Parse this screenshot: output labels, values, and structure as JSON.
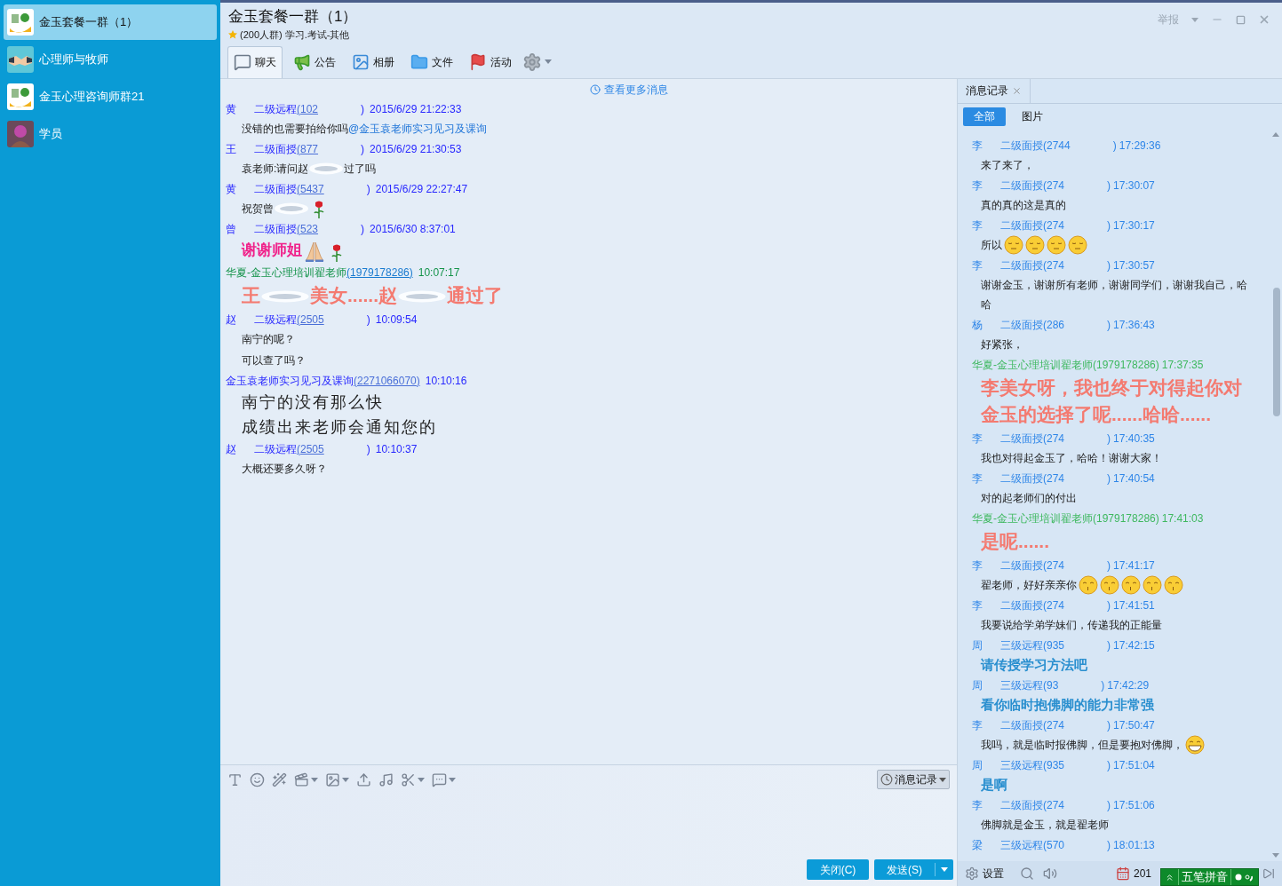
{
  "sidebar": {
    "items": [
      {
        "label": "金玉套餐一群（1）",
        "kind": "logo",
        "selected": true
      },
      {
        "label": "心理师与牧师",
        "kind": "handshake",
        "selected": false
      },
      {
        "label": "金玉心理咨询师群21",
        "kind": "logo",
        "selected": false
      },
      {
        "label": "学员",
        "kind": "person",
        "selected": false
      }
    ]
  },
  "header": {
    "title": "金玉套餐一群（1）",
    "subtitle": "(200人群) 学习.考试-其他",
    "report": "举报"
  },
  "tabs": [
    {
      "label": "聊天",
      "kind": "chat",
      "selected": true
    },
    {
      "label": "公告",
      "kind": "notice",
      "selected": false
    },
    {
      "label": "相册",
      "kind": "album",
      "selected": false
    },
    {
      "label": "文件",
      "kind": "file",
      "selected": false
    },
    {
      "label": "活动",
      "kind": "event",
      "selected": false
    }
  ],
  "chat": {
    "more_link": "查看更多消息",
    "messages": [
      {
        "sender": {
          "name": "黄",
          "role": "二级远程",
          "handle": "(102",
          "handle_end": ")",
          "time": "2015/6/29 21:22:33",
          "kind": "member"
        },
        "kind": "plain",
        "lines": [
          [
            {
              "kind": "text",
              "text": "没错的也需要拍给你吗"
            },
            {
              "kind": "mention",
              "text": "@金玉袁老师实习见习及课询"
            }
          ]
        ]
      },
      {
        "sender": {
          "name": "王",
          "role": "二级面授",
          "handle": "(877",
          "handle_end": ")",
          "time": "2015/6/29 21:30:53",
          "kind": "member"
        },
        "kind": "plain",
        "lines": [
          [
            {
              "kind": "text",
              "text": "袁老师:请问赵"
            },
            {
              "kind": "blur"
            },
            {
              "kind": "text",
              "text": "过了吗"
            }
          ]
        ]
      },
      {
        "sender": {
          "name": "黄",
          "role": "二级面授",
          "handle": "(5437",
          "handle_end": ")",
          "time": "2015/6/29 22:27:47",
          "kind": "member"
        },
        "kind": "plain",
        "lines": [
          [
            {
              "kind": "text",
              "text": "祝贺曾"
            },
            {
              "kind": "blur"
            },
            {
              "kind": "rose"
            }
          ]
        ]
      },
      {
        "sender": {
          "name": "曾",
          "role": "二级面授",
          "handle": "(523",
          "handle_end": ")",
          "time": "2015/6/30 8:37:01",
          "kind": "member"
        },
        "kind": "pink",
        "lines": [
          [
            {
              "kind": "text",
              "text": "谢谢师姐"
            },
            {
              "kind": "pray"
            },
            {
              "kind": "rose"
            }
          ]
        ]
      },
      {
        "sender": {
          "name": "华夏-金玉心理培训翟老师",
          "handle": "(1979178286)",
          "time": "10:07:17",
          "kind": "teacher"
        },
        "kind": "salmon",
        "lines": [
          [
            {
              "kind": "text",
              "text": "王"
            },
            {
              "kind": "blur"
            },
            {
              "kind": "text",
              "text": "美女......赵"
            },
            {
              "kind": "blur"
            },
            {
              "kind": "text",
              "text": "通过了"
            }
          ]
        ]
      },
      {
        "sender": {
          "name": "赵",
          "role": "二级远程",
          "handle": "(2505",
          "handle_end": ")",
          "time": "10:09:54",
          "kind": "member"
        },
        "kind": "plain",
        "lines": [
          [
            {
              "kind": "text",
              "text": "南宁的呢？"
            }
          ],
          [
            {
              "kind": "text",
              "text": "可以查了吗？"
            }
          ]
        ]
      },
      {
        "sender": {
          "name": "金玉袁老师实习见习及课询",
          "handle": "(2271066070)",
          "time": "10:10:16",
          "kind": "member"
        },
        "kind": "large",
        "lines": [
          [
            {
              "kind": "text",
              "text": "南宁的没有那么快"
            }
          ],
          [
            {
              "kind": "text",
              "text": "成绩出来老师会通知您的"
            }
          ]
        ]
      },
      {
        "sender": {
          "name": "赵",
          "role": "二级远程",
          "handle": "(2505",
          "handle_end": ")",
          "time": "10:10:37",
          "kind": "member"
        },
        "kind": "plain",
        "lines": [
          [
            {
              "kind": "text",
              "text": "大概还要多久呀？"
            }
          ]
        ]
      }
    ]
  },
  "composer": {
    "history_button": "消息记录",
    "close_button": "关闭(C)",
    "send_button": "发送(S)"
  },
  "history": {
    "tab": "消息记录",
    "filters": [
      {
        "label": "全部",
        "selected": true
      },
      {
        "label": "图片",
        "selected": false
      }
    ],
    "messages": [
      {
        "sender": {
          "name": "李",
          "role": "二级面授(2744",
          "handle_end": ")",
          "time": "17:29:36",
          "kind": "member"
        },
        "kind": "plain",
        "lines": [
          [
            {
              "kind": "text",
              "text": "来了来了，"
            }
          ]
        ]
      },
      {
        "sender": {
          "name": "李",
          "role": "二级面授(274",
          "handle_end": ")",
          "time": "17:30:07",
          "kind": "member"
        },
        "kind": "plain",
        "lines": [
          [
            {
              "kind": "text",
              "text": "真的真的这是真的"
            }
          ]
        ]
      },
      {
        "sender": {
          "name": "李",
          "role": "二级面授(274",
          "handle_end": ")",
          "time": "17:30:17",
          "kind": "member"
        },
        "kind": "plain",
        "lines": [
          [
            {
              "kind": "text",
              "text": "所以"
            },
            {
              "kind": "sleepy"
            },
            {
              "kind": "sleepy"
            },
            {
              "kind": "sleepy"
            },
            {
              "kind": "sleepy"
            }
          ]
        ]
      },
      {
        "sender": {
          "name": "李",
          "role": "二级面授(274",
          "handle_end": ")",
          "time": "17:30:57",
          "kind": "member"
        },
        "kind": "plain",
        "lines": [
          [
            {
              "kind": "text",
              "text": "谢谢金玉，谢谢所有老师，谢谢同学们，谢谢我自己，哈哈"
            }
          ]
        ]
      },
      {
        "sender": {
          "name": "杨",
          "role": "二级面授(286",
          "handle_end": ")",
          "time": "17:36:43",
          "kind": "member"
        },
        "kind": "plain",
        "lines": [
          [
            {
              "kind": "text",
              "text": "好紧张，"
            }
          ]
        ]
      },
      {
        "sender": {
          "name": "华夏-金玉心理培训翟老师(1979178286)",
          "time": "17:37:35",
          "kind": "teacher"
        },
        "kind": "salmon",
        "lines": [
          [
            {
              "kind": "text",
              "text": "李美女呀，我也终于对得起你对金玉的选择了呢......哈哈......"
            }
          ]
        ]
      },
      {
        "sender": {
          "name": "李",
          "role": "二级面授(274",
          "handle_end": ")",
          "time": "17:40:35",
          "kind": "member"
        },
        "kind": "plain",
        "lines": [
          [
            {
              "kind": "text",
              "text": "我也对得起金玉了，哈哈！谢谢大家！"
            }
          ]
        ]
      },
      {
        "sender": {
          "name": "李",
          "role": "二级面授(274",
          "handle_end": ")",
          "time": "17:40:54",
          "kind": "member"
        },
        "kind": "plain",
        "lines": [
          [
            {
              "kind": "text",
              "text": "对的起老师们的付出"
            }
          ]
        ]
      },
      {
        "sender": {
          "name": "华夏-金玉心理培训翟老师(1979178286)",
          "time": "17:41:03",
          "kind": "teacher"
        },
        "kind": "salmon",
        "lines": [
          [
            {
              "kind": "text",
              "text": "是呢......"
            }
          ]
        ]
      },
      {
        "sender": {
          "name": "李",
          "role": "二级面授(274",
          "handle_end": ")",
          "time": "17:41:17",
          "kind": "member"
        },
        "kind": "plain",
        "lines": [
          [
            {
              "kind": "text",
              "text": "翟老师，好好亲亲你"
            },
            {
              "kind": "kiss"
            },
            {
              "kind": "kiss"
            },
            {
              "kind": "kiss"
            },
            {
              "kind": "kiss"
            },
            {
              "kind": "kiss"
            }
          ]
        ]
      },
      {
        "sender": {
          "name": "李",
          "role": "二级面授(274",
          "handle_end": ")",
          "time": "17:41:51",
          "kind": "member"
        },
        "kind": "plain",
        "lines": [
          [
            {
              "kind": "text",
              "text": "我要说给学弟学妹们，传递我的正能量"
            }
          ]
        ]
      },
      {
        "sender": {
          "name": "周",
          "role": "三级远程(935",
          "handle_end": ")",
          "time": "17:42:15",
          "kind": "member"
        },
        "kind": "bold_blue",
        "lines": [
          [
            {
              "kind": "text",
              "text": "请传授学习方法吧"
            }
          ]
        ]
      },
      {
        "sender": {
          "name": "周",
          "role": "三级远程(93",
          "handle_end": ")",
          "time": "17:42:29",
          "kind": "member"
        },
        "kind": "bold_blue",
        "lines": [
          [
            {
              "kind": "text",
              "text": "看你临时抱佛脚的能力非常强"
            }
          ]
        ]
      },
      {
        "sender": {
          "name": "李",
          "role": "二级面授(274",
          "handle_end": ")",
          "time": "17:50:47",
          "kind": "member"
        },
        "kind": "plain",
        "lines": [
          [
            {
              "kind": "text",
              "text": "我吗，就是临时报佛脚，但是要抱对佛脚，"
            },
            {
              "kind": "grin"
            }
          ]
        ]
      },
      {
        "sender": {
          "name": "周",
          "role": "三级远程(935",
          "handle_end": ")",
          "time": "17:51:04",
          "kind": "member"
        },
        "kind": "bold_blue",
        "lines": [
          [
            {
              "kind": "text",
              "text": "是啊"
            }
          ]
        ]
      },
      {
        "sender": {
          "name": "李",
          "role": "二级面授(274",
          "handle_end": ")",
          "time": "17:51:06",
          "kind": "member"
        },
        "kind": "plain",
        "lines": [
          [
            {
              "kind": "text",
              "text": "佛脚就是金玉，就是翟老师"
            }
          ]
        ]
      },
      {
        "sender": {
          "name": "梁",
          "role": "三级远程(570",
          "handle_end": ")",
          "time": "18:01:13",
          "kind": "member"
        }
      }
    ],
    "settings": "设置",
    "date": "201"
  },
  "ime": {
    "label": "五笔拼音"
  }
}
